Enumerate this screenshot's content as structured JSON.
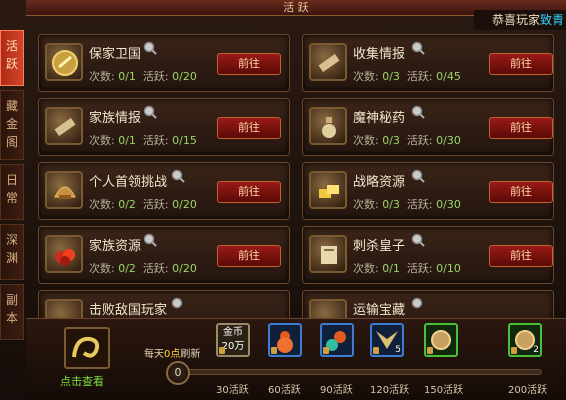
{
  "window": {
    "title": "活 跃"
  },
  "news_ticker": {
    "prefix": "恭喜玩家",
    "highlight": "致青"
  },
  "side_tabs": [
    {
      "label": "活跃",
      "active": true
    },
    {
      "label": "藏金阁",
      "active": false
    },
    {
      "label": "日常",
      "active": false
    },
    {
      "label": "深渊",
      "active": false
    },
    {
      "label": "副本",
      "active": false
    }
  ],
  "labels": {
    "count": "次数:",
    "active": "活跃:",
    "go": "前往"
  },
  "tasks": [
    {
      "title": "保家卫国",
      "count": "0/1",
      "active": "0/20",
      "icon": "shield-coin-icon"
    },
    {
      "title": "收集情报",
      "count": "0/3",
      "active": "0/45",
      "icon": "scroll-icon"
    },
    {
      "title": "家族情报",
      "count": "0/1",
      "active": "0/15",
      "icon": "scroll-icon"
    },
    {
      "title": "魔神秘药",
      "count": "0/3",
      "active": "0/30",
      "icon": "potion-icon"
    },
    {
      "title": "个人首领挑战",
      "count": "0/2",
      "active": "0/20",
      "icon": "boss-helmet-icon"
    },
    {
      "title": "战略资源",
      "count": "0/3",
      "active": "0/30",
      "icon": "gold-ingot-icon"
    },
    {
      "title": "家族资源",
      "count": "0/2",
      "active": "0/20",
      "icon": "red-ore-icon"
    },
    {
      "title": "刺杀皇子",
      "count": "0/1",
      "active": "0/10",
      "icon": "decree-icon"
    },
    {
      "title": "击败敌国玩家",
      "icon": "sword-icon"
    },
    {
      "title": "运输宝藏",
      "icon": "chest-icon"
    }
  ],
  "bottom": {
    "view_label": "点击查看",
    "refresh_text_1": "每天",
    "refresh_text_hl": "0点",
    "refresh_text_2": "刷新",
    "current_points": "0",
    "coin_label": "金币",
    "coin_amount": "20万",
    "milestones": [
      "30活跃",
      "60活跃",
      "90活跃",
      "120活跃",
      "150活跃",
      "200活跃"
    ],
    "rewards": [
      {
        "icon": "gourd-icon",
        "count": "",
        "frame": "blue"
      },
      {
        "icon": "gourd-potion-icon",
        "count": "",
        "frame": "blue"
      },
      {
        "icon": "wings-icon",
        "count": "5",
        "frame": "blue"
      },
      {
        "icon": "orb-icon",
        "count": "",
        "frame": "green"
      },
      {
        "icon": "orb-icon",
        "count": "2",
        "frame": "green"
      }
    ]
  }
}
